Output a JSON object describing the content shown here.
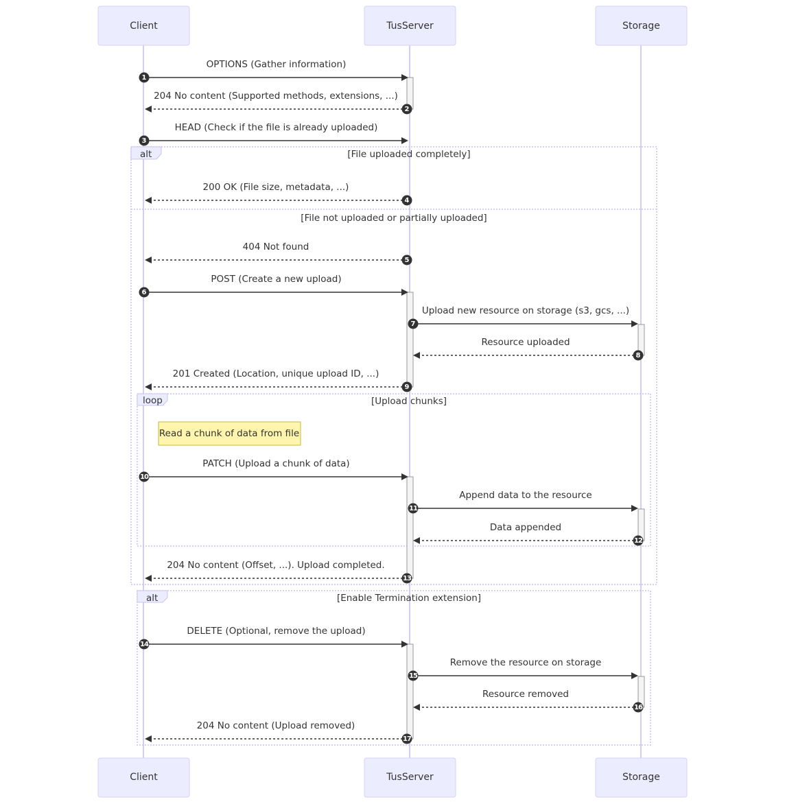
{
  "diagram": {
    "type": "sequence",
    "actors": [
      {
        "id": "client",
        "label": "Client"
      },
      {
        "id": "tusserver",
        "label": "TusServer"
      },
      {
        "id": "storage",
        "label": "Storage"
      }
    ],
    "messages": [
      {
        "seq": "1",
        "from": "client",
        "to": "tusserver",
        "label": "OPTIONS (Gather information)",
        "style": "solid"
      },
      {
        "seq": "2",
        "from": "tusserver",
        "to": "client",
        "label": "204 No content (Supported methods, extensions, ...)",
        "style": "dashed"
      },
      {
        "seq": "3",
        "from": "client",
        "to": "tusserver",
        "label": "HEAD (Check if the file is already uploaded)",
        "style": "solid"
      },
      {
        "seq": "4",
        "from": "tusserver",
        "to": "client",
        "label": "200 OK (File size, metadata, ...)",
        "style": "dashed"
      },
      {
        "seq": "5",
        "from": "tusserver",
        "to": "client",
        "label": "404 Not found",
        "style": "dashed"
      },
      {
        "seq": "6",
        "from": "client",
        "to": "tusserver",
        "label": "POST (Create a new upload)",
        "style": "solid"
      },
      {
        "seq": "7",
        "from": "tusserver",
        "to": "storage",
        "label": "Upload new resource on storage (s3, gcs, ...)",
        "style": "solid"
      },
      {
        "seq": "8",
        "from": "storage",
        "to": "tusserver",
        "label": "Resource uploaded",
        "style": "dashed"
      },
      {
        "seq": "9",
        "from": "tusserver",
        "to": "client",
        "label": "201 Created (Location, unique upload ID, ...)",
        "style": "dashed"
      },
      {
        "seq": "10",
        "from": "client",
        "to": "tusserver",
        "label": "PATCH (Upload a chunk of data)",
        "style": "solid"
      },
      {
        "seq": "11",
        "from": "tusserver",
        "to": "storage",
        "label": "Append data to the resource",
        "style": "solid"
      },
      {
        "seq": "12",
        "from": "storage",
        "to": "tusserver",
        "label": "Data appended",
        "style": "dashed"
      },
      {
        "seq": "13",
        "from": "tusserver",
        "to": "client",
        "label": "204 No content (Offset, ...). Upload completed.",
        "style": "dashed"
      },
      {
        "seq": "14",
        "from": "client",
        "to": "tusserver",
        "label": "DELETE (Optional, remove the upload)",
        "style": "solid"
      },
      {
        "seq": "15",
        "from": "tusserver",
        "to": "storage",
        "label": "Remove the resource on storage",
        "style": "solid"
      },
      {
        "seq": "16",
        "from": "storage",
        "to": "tusserver",
        "label": "Resource removed",
        "style": "dashed"
      },
      {
        "seq": "17",
        "from": "tusserver",
        "to": "client",
        "label": "204 No content (Upload removed)",
        "style": "dashed"
      }
    ],
    "fragments": [
      {
        "kind": "alt",
        "label": "alt",
        "condition": "[File uploaded completely]",
        "else_condition": "[File not uploaded or partially uploaded]"
      },
      {
        "kind": "loop",
        "label": "loop",
        "condition": "[Upload chunks]"
      },
      {
        "kind": "alt",
        "label": "alt",
        "condition": "[Enable Termination extension]"
      }
    ],
    "note": {
      "over": "client",
      "text": "Read a chunk of data from file"
    }
  }
}
